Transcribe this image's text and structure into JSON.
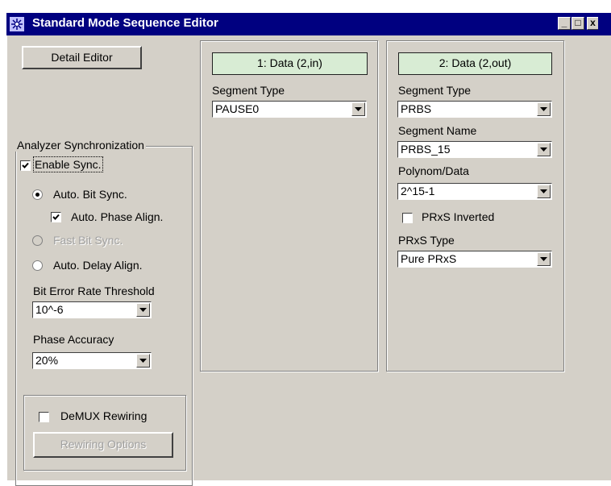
{
  "window": {
    "title": "Standard Mode Sequence Editor",
    "minimize": "_",
    "maximize": "□",
    "close": "x",
    "icon": "app-icon"
  },
  "detail_editor_button": "Detail Editor",
  "sync": {
    "group_label": "Analyzer Synchronization",
    "enable_sync": "Enable Sync.",
    "enable_sync_checked": true,
    "auto_bit_sync": "Auto. Bit Sync.",
    "auto_phase_align": "Auto. Phase Align.",
    "auto_phase_align_checked": true,
    "fast_bit_sync": "Fast Bit Sync.",
    "auto_delay_align": "Auto. Delay Align.",
    "selected_mode": "auto_bit_sync",
    "ber_label": "Bit Error Rate Threshold",
    "ber_value": "10^-6",
    "phase_label": "Phase Accuracy",
    "phase_value": "20%"
  },
  "demux": {
    "label": "DeMUX Rewiring",
    "checked": false,
    "options_button": "Rewiring Options"
  },
  "segment1": {
    "header": "1: Data  (2,in)",
    "type_label": "Segment Type",
    "type_value": "PAUSE0"
  },
  "segment2": {
    "header": "2: Data  (2,out)",
    "type_label": "Segment Type",
    "type_value": "PRBS",
    "name_label": "Segment Name",
    "name_value": "PRBS_15",
    "poly_label": "Polynom/Data",
    "poly_value": "2^15-1",
    "inverted_label": "PRxS Inverted",
    "inverted_checked": false,
    "prxs_type_label": "PRxS Type",
    "prxs_type_value": "Pure PRxS"
  },
  "colors": {
    "title_bar": "#000080",
    "window_bg": "#d4d0c8",
    "segment_header_bg": "#d8ecd4"
  }
}
